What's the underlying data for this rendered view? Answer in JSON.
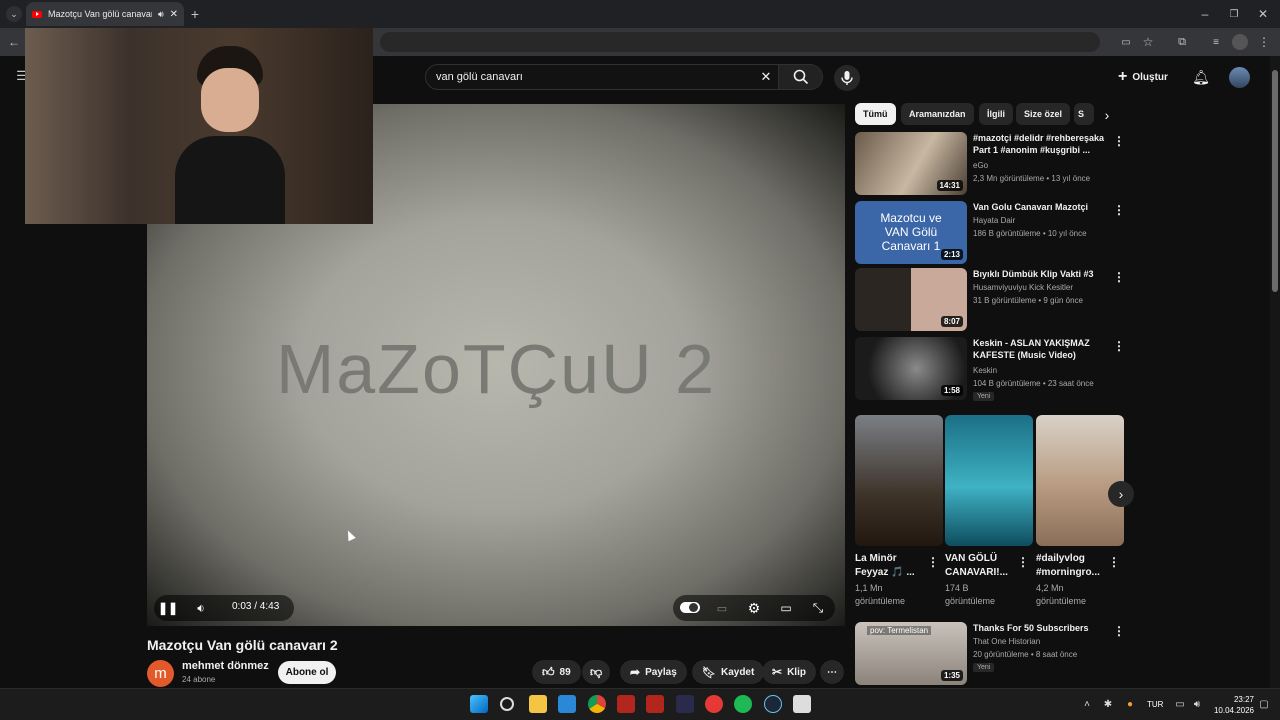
{
  "browser": {
    "tab_title": "Mazotçu Van gölü canavar",
    "new_tab": "+"
  },
  "youtube": {
    "search_query": "van gölü canavarı",
    "create_label": "Oluştur"
  },
  "player": {
    "watermark": "MaZoTÇuU 2",
    "time": "0:03 / 4:43",
    "progress_fraction": 0.011
  },
  "video": {
    "title": "Mazotçu Van gölü canavarı 2",
    "channel_initial": "m",
    "channel_name": "mehmet dönmez",
    "subscribers": "24 abone",
    "subscribe_label": "Abone ol",
    "likes": "89",
    "share_label": "Paylaş",
    "save_label": "Kaydet",
    "clip_label": "Klip"
  },
  "chips": [
    "Tümü",
    "Aramanızdan",
    "İlgili",
    "Size özel",
    "S"
  ],
  "recommendations": [
    {
      "title": "#mazotçi #delidr  #rehbereşaka Part 1 #anonim #kuşgribi ...",
      "channel": "eGo",
      "meta": "2,3 Mn görüntüleme • 13 yıl önce",
      "duration": "14:31",
      "badge": ""
    },
    {
      "title": "Van Golu Canavarı Mazotçi",
      "channel": "Hayata Dair",
      "meta": "186 B görüntüleme • 10 yıl önce",
      "duration": "2:13",
      "badge": "",
      "thumb_text": "Mazotcu ve VAN Gölü Canavarı 1"
    },
    {
      "title": "Bıyıklı Dümbük Klip Vakti #3",
      "channel": "Husamviyuviyu Kick Kesitler",
      "meta": "31 B görüntüleme • 9 gün önce",
      "duration": "8:07",
      "badge": ""
    },
    {
      "title": "Keskin - ASLAN YAKIŞMAZ KAFESTE (Music Video)",
      "channel": "Keskin",
      "meta": "104 B görüntüleme • 23 saat önce",
      "duration": "1:58",
      "badge": "Yeni"
    },
    {
      "title": "Thanks For 50 Subscribers",
      "channel": "That One Historian",
      "meta": "20 görüntüleme • 8 saat önce",
      "duration": "1:35",
      "badge": "Yeni",
      "thumb_text": "pov: Termelistan"
    }
  ],
  "shorts": [
    {
      "title": "La Minör Feyyaz 🎵 ...",
      "views": "1,1 Mn görüntüleme"
    },
    {
      "title": "VAN GÖLÜ CANAVARI!...",
      "views": "174 B görüntüleme"
    },
    {
      "title": "#dailyvlog #morningro...",
      "views": "4,2 Mn görüntüleme"
    }
  ],
  "taskbar": {
    "lang": "TUR",
    "time": "23:27",
    "date": "10.04.2026"
  },
  "colors": {
    "accent": "#ff0000",
    "background": "#0f0f0f",
    "chip": "#272727"
  }
}
